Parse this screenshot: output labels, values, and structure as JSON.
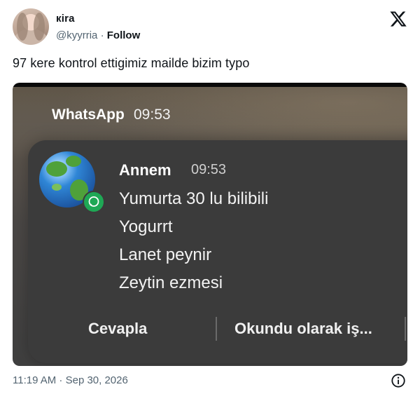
{
  "author": {
    "name": "кira",
    "handle": "@kyyrria",
    "separator": "·",
    "follow_label": "Follow"
  },
  "tweet": {
    "text": "97 kere kontrol ettigimiz mailde bizim typo",
    "timestamp": "11:19 AM · Sep 30, 2026"
  },
  "screenshot": {
    "app_name": "WhatsApp",
    "app_time": "09:53",
    "notification": {
      "sender": "Annem",
      "time": "09:53",
      "lines": [
        "Yumurta 30 lu bilibili",
        "Yogurrt",
        "Lanet peynir",
        "Zeytin ezmesi"
      ],
      "actions": [
        "Cevapla",
        "Okundu olarak iş..."
      ]
    }
  },
  "icons": {
    "logo": "x-logo-icon",
    "info": "info-icon",
    "avatar_badge": "whatsapp-icon"
  },
  "colors": {
    "whatsapp_green": "#1fa855",
    "card_bg": "#3b3b3b",
    "muted_text": "#536471"
  }
}
